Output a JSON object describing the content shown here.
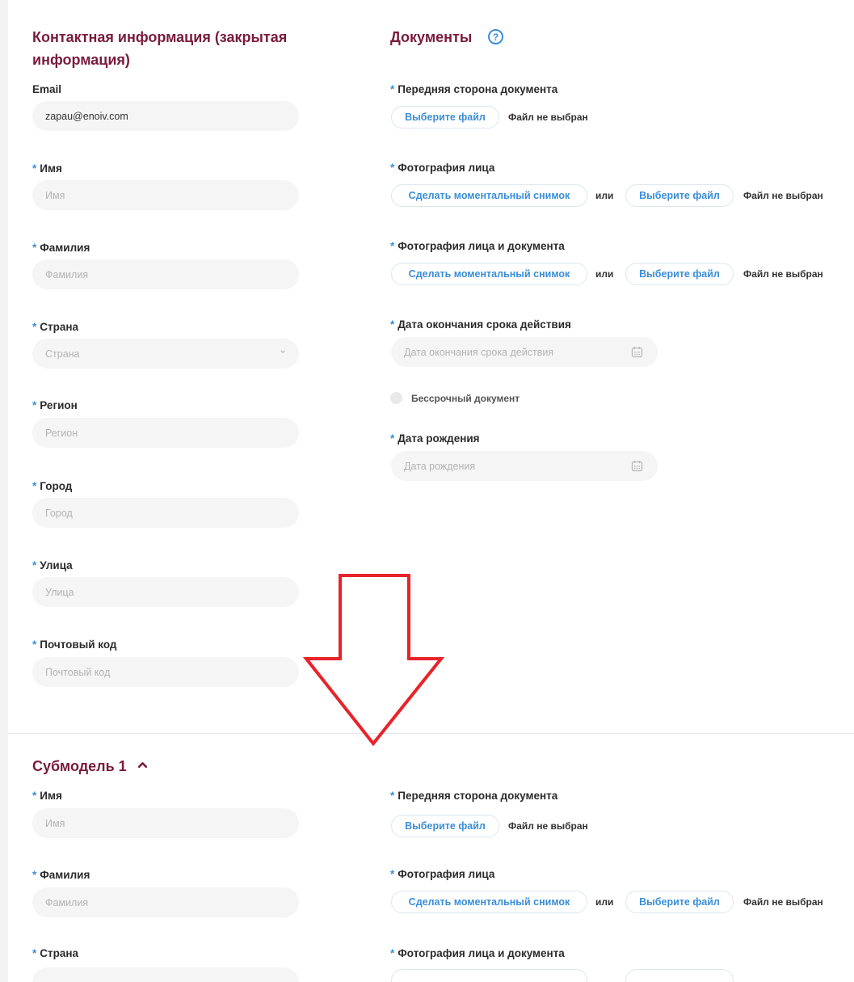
{
  "contact": {
    "title_line1": "Контактная информация (закрытая",
    "title_line2": "информация)",
    "email_label": "Email",
    "email_value": "zapau@enoiv.com",
    "required_mark": "*",
    "first_name": {
      "label": "Имя",
      "placeholder": "Имя"
    },
    "last_name": {
      "label": "Фамилия",
      "placeholder": "Фамилия"
    },
    "country": {
      "label": "Страна",
      "placeholder": "Страна"
    },
    "region": {
      "label": "Регион",
      "placeholder": "Регион"
    },
    "city": {
      "label": "Город",
      "placeholder": "Город"
    },
    "street": {
      "label": "Улица",
      "placeholder": "Улица"
    },
    "postal": {
      "label": "Почтовый код",
      "placeholder": "Почтовый код"
    }
  },
  "documents": {
    "title": "Документы",
    "help_icon": "?",
    "front": {
      "label": "Передняя сторона документа",
      "choose": "Выберите файл",
      "no_file": "Файл не выбран"
    },
    "face": {
      "label": "Фотография лица",
      "snapshot": "Сделать моментальный снимок",
      "or": "или",
      "choose": "Выберите файл",
      "no_file": "Файл не выбран"
    },
    "face_doc": {
      "label": "Фотография лица и документа",
      "snapshot": "Сделать моментальный снимок",
      "or": "или",
      "choose": "Выберите файл",
      "no_file": "Файл не выбран"
    },
    "expiry": {
      "label": "Дата окончания срока действия",
      "placeholder": "Дата окончания срока действия"
    },
    "indefinite": "Бессрочный документ",
    "birth": {
      "label": "Дата рождения",
      "placeholder": "Дата рождения"
    }
  },
  "submodel": {
    "title": "Субмодель 1",
    "first_name": {
      "label": "Имя",
      "placeholder": "Имя"
    },
    "last_name": {
      "label": "Фамилия",
      "placeholder": "Фамилия"
    },
    "country": {
      "label": "Страна"
    },
    "front": {
      "label": "Передняя сторона документа",
      "choose": "Выберите файл",
      "no_file": "Файл не выбран"
    },
    "face": {
      "label": "Фотография лица",
      "snapshot": "Сделать моментальный снимок",
      "or": "или",
      "choose": "Выберите файл",
      "no_file": "Файл не выбран"
    },
    "face_doc": {
      "label": "Фотография лица и документа"
    }
  },
  "colors": {
    "title": "#7a1b3d",
    "accent": "#3a8ed8",
    "annotation_arrow": "#e8232a"
  }
}
